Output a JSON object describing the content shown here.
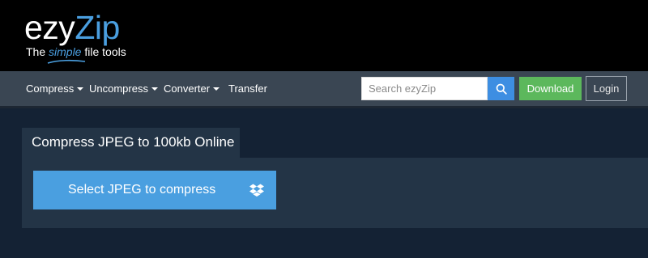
{
  "header": {
    "logo": {
      "word_part1": "ezy",
      "word_part2": "Zip"
    },
    "tagline": {
      "before": "The ",
      "highlight": "simple",
      "after": " file tools"
    }
  },
  "nav": {
    "items": [
      {
        "label": "Compress",
        "has_dropdown": true
      },
      {
        "label": "Uncompress",
        "has_dropdown": true
      },
      {
        "label": "Converter",
        "has_dropdown": true
      },
      {
        "label": "Transfer",
        "has_dropdown": false
      }
    ],
    "search": {
      "placeholder": "Search ezyZip",
      "value": "",
      "icon": "search-icon"
    },
    "download_label": "Download",
    "login_label": "Login"
  },
  "main": {
    "tab_title": "Compress JPEG to 100kb Online",
    "select_button_label": "Select JPEG to compress",
    "select_button_icon": "dropbox-icon"
  },
  "colors": {
    "header_bg": "#000000",
    "nav_bg": "#3a4653",
    "page_bg": "#142234",
    "panel_bg": "#233446",
    "accent_blue": "#4a9fe0",
    "search_button": "#3d8ee2",
    "download_green": "#5cb85c"
  }
}
